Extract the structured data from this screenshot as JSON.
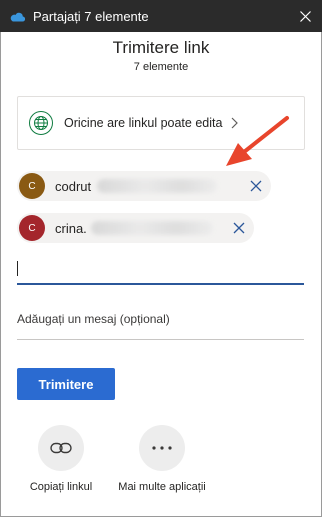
{
  "window": {
    "title": "Partajați 7 elemente"
  },
  "header": {
    "title": "Trimitere link",
    "subtitle": "7 elemente"
  },
  "permission": {
    "text": "Oricine are linkul poate edita"
  },
  "recipients": [
    {
      "initial": "C",
      "name": "codrut",
      "color": "#8a5a13"
    },
    {
      "initial": "C",
      "name": "crina.",
      "color": "#a4262c"
    }
  ],
  "message": {
    "placeholder": "Adăugați un mesaj (opțional)"
  },
  "send": {
    "label": "Trimitere"
  },
  "actions": [
    {
      "label": "Copiați linkul",
      "icon": "link-icon"
    },
    {
      "label": "Mai multe aplicații",
      "icon": "more-icon"
    }
  ],
  "colors": {
    "accent": "#2b6bd1",
    "titlebar": "#2b2b2b",
    "annotation": "#e8452c"
  }
}
